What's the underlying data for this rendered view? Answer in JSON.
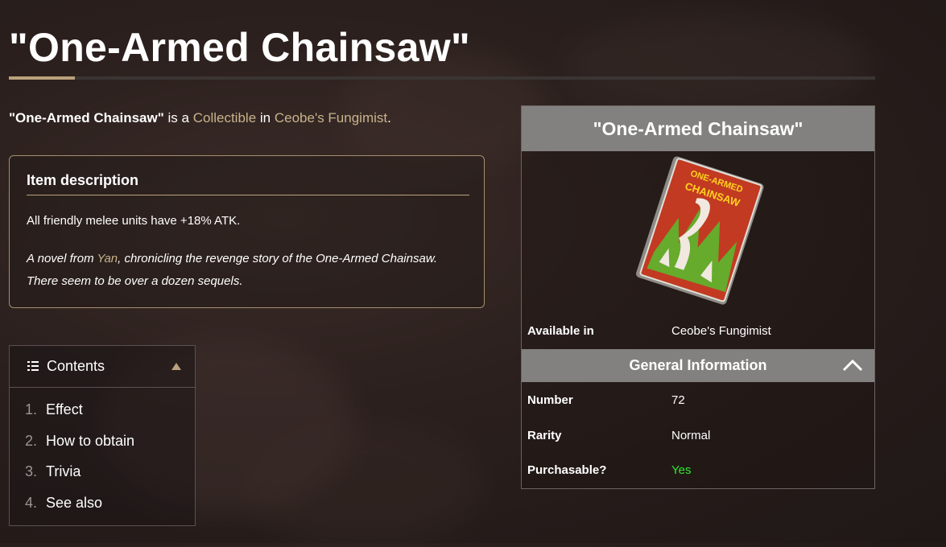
{
  "page": {
    "title": "\"One-Armed Chainsaw\"",
    "intro": {
      "item_name": "\"One-Armed Chainsaw\"",
      "is_a": "is a",
      "type_link": "Collectible",
      "in": "in",
      "mode_link": "Ceobe's Fungimist",
      "end": "."
    }
  },
  "description": {
    "heading": "Item description",
    "effect": "All friendly melee units have +18% ATK.",
    "flavor_before": "A novel from ",
    "flavor_link": "Yan",
    "flavor_after": ", chronicling the revenge story of the One-Armed Chainsaw. There seem to be over a dozen sequels."
  },
  "contents": {
    "heading": "Contents",
    "items": [
      {
        "num": "1.",
        "label": "Effect"
      },
      {
        "num": "2.",
        "label": "How to obtain"
      },
      {
        "num": "3.",
        "label": "Trivia"
      },
      {
        "num": "4.",
        "label": "See also"
      }
    ]
  },
  "infobox": {
    "title": "\"One-Armed Chainsaw\"",
    "image": {
      "cover_text_1": "ONE-ARMED",
      "cover_text_2": "CHAINSAW"
    },
    "available_label": "Available in",
    "available_value": "Ceobe's Fungimist",
    "section_title": "General Information",
    "rows": [
      {
        "label": "Number",
        "value": "72"
      },
      {
        "label": "Rarity",
        "value": "Normal"
      },
      {
        "label": "Purchasable?",
        "value": "Yes"
      }
    ]
  },
  "colors": {
    "accent": "#b9a27c",
    "link": "#c9b38c",
    "header_bar": "#828180",
    "yes_green": "#2ee62e"
  },
  "icons": [
    "list-icon",
    "caret-up-icon",
    "chevron-up-icon"
  ]
}
